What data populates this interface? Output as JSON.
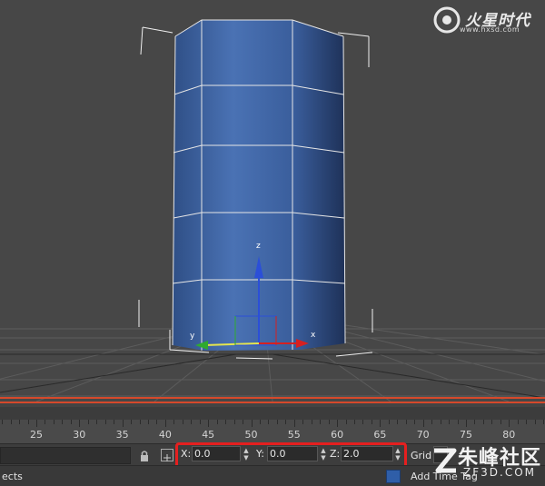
{
  "watermark_top": {
    "brand": "火星时代",
    "url": "www.hxsd.com"
  },
  "viewport": {
    "gizmo": {
      "x_label": "x",
      "y_label": "y",
      "z_label": "z"
    },
    "colors": {
      "background": "#474747",
      "object": "#3f66a6",
      "wire": "#e6e6e6",
      "x_axis": "#d62020",
      "y_axis": "#2faa2f",
      "z_axis": "#2b4fd8"
    }
  },
  "timeline": {
    "ticks": [
      "25",
      "30",
      "35",
      "40",
      "45",
      "50",
      "55",
      "60",
      "65",
      "70",
      "75",
      "80"
    ],
    "accent": "#d6492b"
  },
  "coords": {
    "x_label": "X:",
    "x_value": "0.0",
    "y_label": "Y:",
    "y_value": "0.0",
    "z_label": "Z:",
    "z_value": "2.0"
  },
  "grid": {
    "label": "Grid"
  },
  "status": {
    "prompt": "ects",
    "time_tag": "Add Time Tag"
  },
  "logo_bottom": {
    "title": "朱峰社区",
    "sub": "ZF3D.COM"
  },
  "icons": [
    "lock-icon",
    "absolute-mode-icon",
    "spinner-icon",
    "time-tag-icon"
  ]
}
